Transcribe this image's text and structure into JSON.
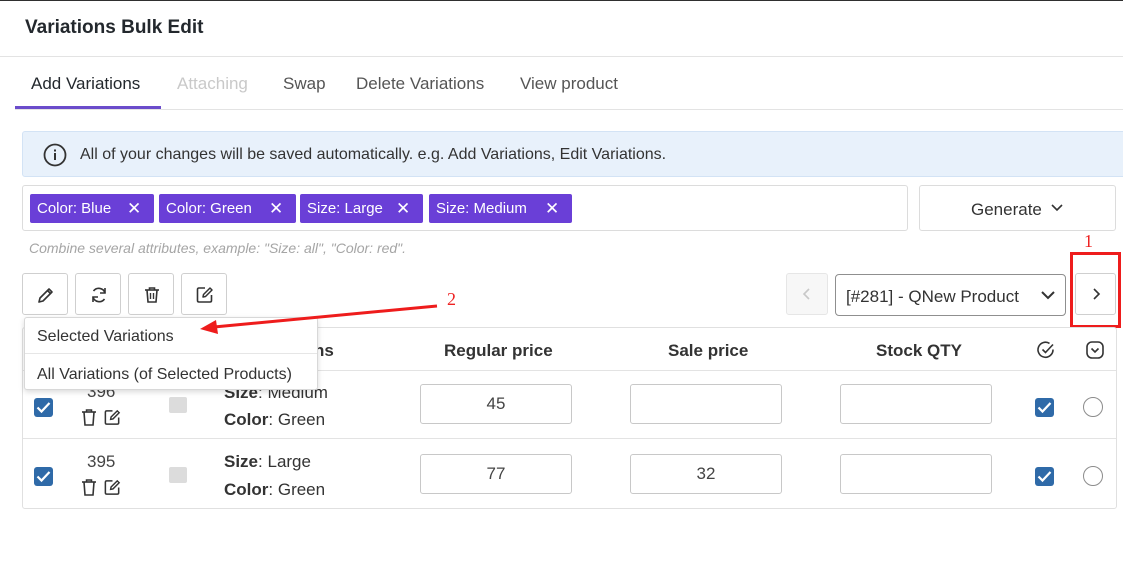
{
  "header": {
    "title": "Variations Bulk Edit"
  },
  "tabs": [
    {
      "label": "Add Variations",
      "state": "active"
    },
    {
      "label": "Attaching",
      "state": "disabled"
    },
    {
      "label": "Swap",
      "state": "normal"
    },
    {
      "label": "Delete Variations",
      "state": "normal"
    },
    {
      "label": "View product",
      "state": "normal"
    }
  ],
  "notice": {
    "icon": "info-icon",
    "text": "All of your changes will be saved automatically. e.g. Add Variations, Edit Variations."
  },
  "attributes": {
    "chips": [
      "Color: Blue",
      "Color: Green",
      "Size: Large",
      "Size: Medium"
    ],
    "remove_glyph": "✕",
    "hint": "Combine several attributes, example: \"Size: all\", \"Color: red\"."
  },
  "generate": {
    "label": "Generate",
    "icon": "chevron-down-icon"
  },
  "toolbar": {
    "buttons": [
      {
        "name": "edit-pencil-button",
        "icon": "pencil-icon"
      },
      {
        "name": "refresh-button",
        "icon": "refresh-icon"
      },
      {
        "name": "delete-button",
        "icon": "trash-icon"
      },
      {
        "name": "bulk-edit-button",
        "icon": "edit-square-icon"
      }
    ]
  },
  "pager": {
    "selected_product": "[#281] - QNew Product"
  },
  "annotations": {
    "one": "1",
    "two": "2",
    "color": "#ee1c1c"
  },
  "dropdown": {
    "items": [
      "Selected Variations",
      "All Variations (of Selected Products)"
    ]
  },
  "table": {
    "headers": {
      "attributes": "ns",
      "regular_price": "Regular price",
      "sale_price": "Sale price",
      "stock_qty": "Stock QTY"
    },
    "rows": [
      {
        "id": "396",
        "size_label": "Size",
        "size": "Medium",
        "color_label": "Color",
        "color": "Green",
        "regular_price": "45",
        "sale_price": "",
        "stock_qty": ""
      },
      {
        "id": "395",
        "size_label": "Size",
        "size": "Large",
        "color_label": "Color",
        "color": "Green",
        "regular_price": "77",
        "sale_price": "32",
        "stock_qty": ""
      }
    ]
  },
  "colors": {
    "accent": "#6a3fd7",
    "tab_underline": "#6b4ccb",
    "checkbox": "#2f6aa8",
    "notice_bg": "#e8f1fb"
  }
}
